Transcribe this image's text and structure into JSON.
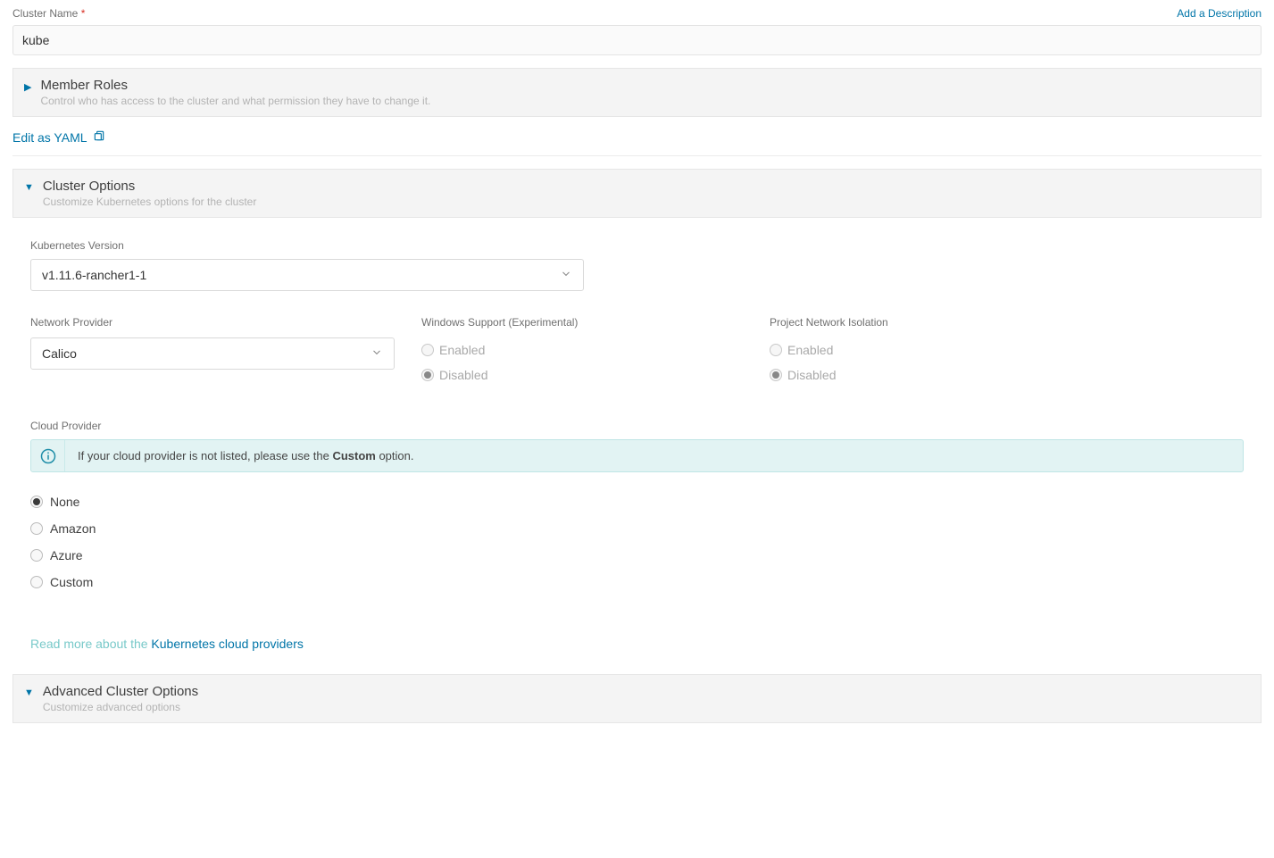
{
  "clusterName": {
    "label": "Cluster Name",
    "value": "kube",
    "addDescriptionLink": "Add a Description"
  },
  "memberRoles": {
    "title": "Member Roles",
    "subtitle": "Control who has access to the cluster and what permission they have to change it."
  },
  "editYamlLink": "Edit as YAML",
  "clusterOptions": {
    "title": "Cluster Options",
    "subtitle": "Customize Kubernetes options for the cluster"
  },
  "k8sVersion": {
    "label": "Kubernetes Version",
    "value": "v1.11.6-rancher1-1"
  },
  "networkProvider": {
    "label": "Network Provider",
    "value": "Calico"
  },
  "windowsSupport": {
    "label": "Windows Support (Experimental)",
    "enabledLabel": "Enabled",
    "disabledLabel": "Disabled"
  },
  "projectIsolation": {
    "label": "Project Network Isolation",
    "enabledLabel": "Enabled",
    "disabledLabel": "Disabled"
  },
  "cloudProvider": {
    "label": "Cloud Provider",
    "infoTextPrefix": "If your cloud provider is not listed, please use the ",
    "infoTextBold": "Custom",
    "infoTextSuffix": " option.",
    "options": {
      "none": "None",
      "amazon": "Amazon",
      "azure": "Azure",
      "custom": "Custom"
    },
    "readMorePrefix": "Read more about the ",
    "readMoreLink": "Kubernetes cloud providers"
  },
  "advancedOptions": {
    "title": "Advanced Cluster Options",
    "subtitle": "Customize advanced options"
  }
}
